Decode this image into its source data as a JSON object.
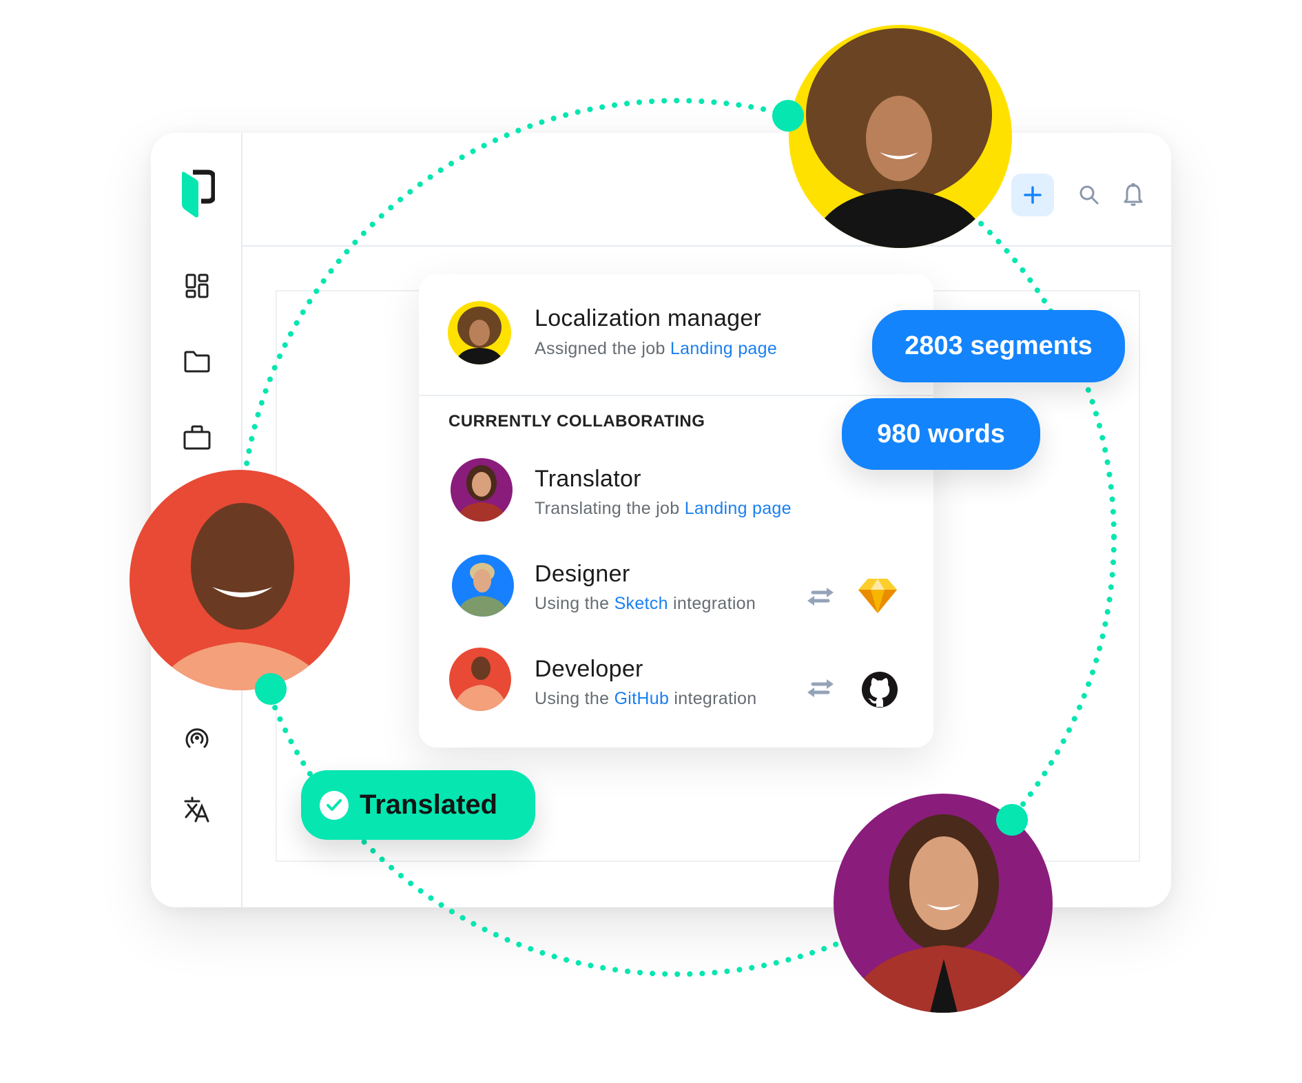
{
  "app": {
    "name": "Phrase",
    "logo_icon": "phrase-logo",
    "sidebar": {
      "items": [
        {
          "id": "dashboard",
          "icon": "dashboard-icon"
        },
        {
          "id": "projects",
          "icon": "folder-icon"
        },
        {
          "id": "jobs",
          "icon": "briefcase-icon"
        },
        {
          "id": "broadcast",
          "icon": "broadcast-icon"
        },
        {
          "id": "translate",
          "icon": "translate-icon"
        }
      ]
    },
    "header": {
      "actions": [
        {
          "id": "add",
          "icon": "plus-icon"
        },
        {
          "id": "search",
          "icon": "search-icon"
        },
        {
          "id": "notifications",
          "icon": "bell-icon"
        }
      ]
    }
  },
  "colors": {
    "accent_green": "#05e6b0",
    "accent_blue": "#1484fc",
    "link_blue": "#1a7ff0",
    "avatar_yellow": "#ffe100",
    "avatar_red": "#e84a35",
    "avatar_purple": "#8a1c7c",
    "avatar_blue": "#1680ff"
  },
  "popup": {
    "owner": {
      "role": "Localization manager",
      "action_prefix": "Assigned the job ",
      "job_link": "Landing page"
    },
    "section_label": "CURRENTLY COLLABORATING",
    "collaborators": [
      {
        "role": "Translator",
        "action_prefix": "Translating the job ",
        "link": "Landing page",
        "action_suffix": "",
        "integration": null
      },
      {
        "role": "Designer",
        "action_prefix": "Using the ",
        "link": "Sketch",
        "action_suffix": " integration",
        "integration": "sketch-icon"
      },
      {
        "role": "Developer",
        "action_prefix": "Using the ",
        "link": "GitHub",
        "action_suffix": " integration",
        "integration": "github-icon"
      }
    ]
  },
  "badges": {
    "segments": "2803 segments",
    "words": "980 words",
    "status": "Translated"
  }
}
